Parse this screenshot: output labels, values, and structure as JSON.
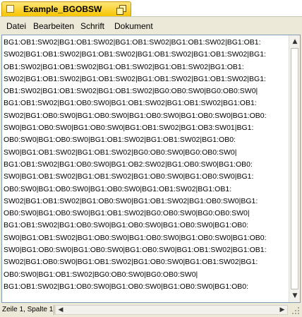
{
  "window": {
    "title": "Example_BGOBSW"
  },
  "menu": {
    "items": [
      "Datei",
      "Bearbeiten",
      "Schrift",
      "Dokument"
    ]
  },
  "editor": {
    "lines": [
      "BG1:OB1:SW02|BG1:OB1:SW02|BG1:OB1:SW02|BG1:OB1:SW02|BG1:OB1:",
      "SW02|BG1:OB1:SW02|BG1:OB1:SW02|BG1:OB1:SW02|BG1:OB1:SW02|BG1:",
      "OB1:SW02|BG1:OB1:SW02|BG1:OB1:SW02|BG1:OB1:SW02|BG1:OB1:",
      "SW02|BG1:OB1:SW02|BG1:OB1:SW02|BG1:OB1:SW02|BG1:OB1:SW02|BG1:",
      "OB1:SW02|BG1:OB1:SW02|BG1:OB1:SW02|BG0:OB0:SW0|BG0:OB0:SW0|",
      "BG1:OB1:SW02|BG1:OB0:SW0|BG1:OB1:SW02|BG1:OB1:SW02|BG1:OB1:",
      "SW02|BG1:OB0:SW0|BG1:OB0:SW0|BG1:OB0:SW0|BG1:OB0:SW0|BG1:OB0:",
      "SW0|BG1:OB0:SW0|BG1:OB0:SW0|BG1:OB1:SW02|BG1:OB3:SW01|BG1:",
      "OB0:SW0|BG1:OB0:SW0|BG1:OB1:SW02|BG1:OB1:SW02|BG1:OB0:",
      "SW0|BG1:OB1:SW02|BG1:OB1:SW02|BG0:OB0:SW0|BG0:OB0:SW0|",
      "BG1:OB1:SW02|BG1:OB0:SW0|BG1:OB2:SW02|BG1:OB0:SW0|BG1:OB0:",
      "SW0|BG1:OB1:SW02|BG1:OB1:SW02|BG1:OB0:SW0|BG1:OB0:SW0|BG1:",
      "OB0:SW0|BG1:OB0:SW0|BG1:OB0:SW0|BG1:OB1:SW02|BG1:OB1:",
      "SW02|BG1:OB1:SW02|BG1:OB0:SW0|BG1:OB1:SW02|BG1:OB0:SW0|BG1:",
      "OB0:SW0|BG1:OB0:SW0|BG1:OB1:SW02|BG0:OB0:SW0|BG0:OB0:SW0|",
      "BG1:OB1:SW02|BG1:OB0:SW0|BG1:OB0:SW0|BG1:OB0:SW0|BG1:OB0:",
      "SW0|BG1:OB1:SW02|BG1:OB0:SW0|BG1:OB0:SW0|BG1:OB0:SW0|BG1:OB0:",
      "SW0|BG1:OB0:SW0|BG1:OB0:SW0|BG1:OB0:SW0|BG1:OB1:SW02|BG1:OB1:",
      "SW02|BG1:OB0:SW0|BG1:OB1:SW02|BG1:OB0:SW0|BG1:OB1:SW02|BG1:",
      "OB0:SW0|BG1:OB1:SW02|BG0:OB0:SW0|BG0:OB0:SW0|",
      "BG1:OB1:SW02|BG1:OB0:SW0|BG1:OB0:SW0|BG1:OB0:SW0|BG1:OB0:"
    ]
  },
  "status": {
    "position": "Zeile 1, Spalte 1"
  },
  "icons": {
    "document": "document-icon",
    "restore": "restore-icon"
  },
  "colors": {
    "tab": "#f6c400",
    "frame": "#ece9d8",
    "editor_border": "#7f9db9"
  }
}
